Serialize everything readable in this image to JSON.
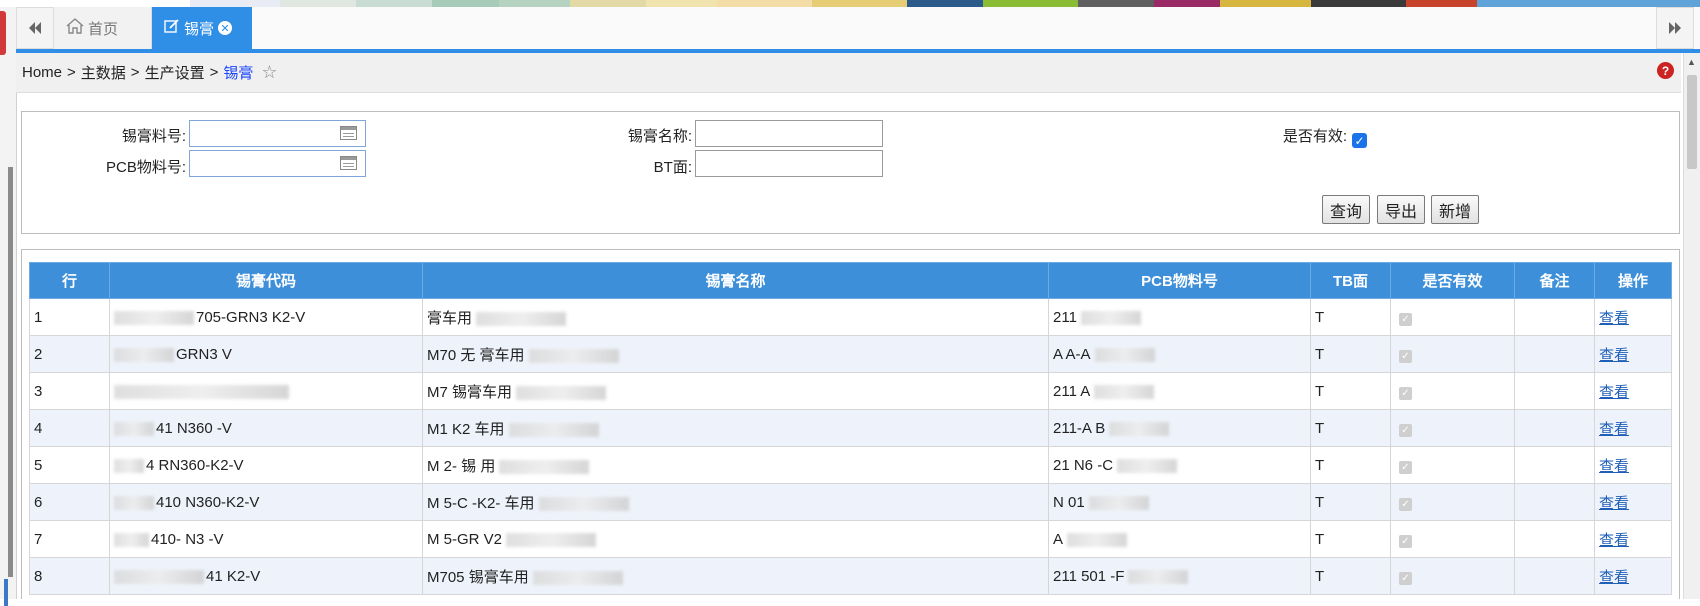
{
  "top_strip_colors": [
    "#ffffff",
    "#e9ecf4",
    "#dfe7e0",
    "#c9dcd3",
    "#a7cbb9",
    "#b6d2c0",
    "#e3d9a6",
    "#f0e3ae",
    "#f3dca6",
    "#e6cd75",
    "#2c5a8a",
    "#8bbc35",
    "#5f5f5f",
    "#9a2a66",
    "#d7b640",
    "#3a3a3a",
    "#c8432b",
    "#5fa3d9"
  ],
  "tabs": {
    "home_label": "首页",
    "active_label": "锡膏",
    "nav_left_icon": "double-chevron-left-icon",
    "nav_right_icon": "double-chevron-right-icon"
  },
  "breadcrumb": {
    "items": [
      "Home",
      "主数据",
      "生产设置"
    ],
    "current": "锡膏",
    "separator": ">"
  },
  "form": {
    "paste_code_label": "锡膏料号:",
    "pcb_code_label": "PCB物料号:",
    "paste_name_label": "锡膏名称:",
    "bt_side_label": "BT面:",
    "active_label": "是否有效:",
    "active_checked": true,
    "query_button": "查询",
    "export_button": "导出",
    "add_button": "新增"
  },
  "grid": {
    "headers": [
      "行",
      "锡膏代码",
      "锡膏名称",
      "PCB物料号",
      "TB面",
      "是否有效",
      "备注",
      "操作"
    ],
    "rows": [
      {
        "row": "1",
        "code": "705-GRN3 K2-V",
        "name": "膏车用",
        "pcb": "211",
        "tb": "T",
        "action": "查看"
      },
      {
        "row": "2",
        "code": "GRN3 V",
        "name": "M70 无 膏车用",
        "pcb": "A A-A",
        "tb": "T",
        "action": "查看"
      },
      {
        "row": "3",
        "code": "",
        "name": "M7 锡膏车用",
        "pcb": "211 A",
        "tb": "T",
        "action": "查看"
      },
      {
        "row": "4",
        "code": "41 N360 -V",
        "name": "M1 K2 车用",
        "pcb": "211-A B",
        "tb": "T",
        "action": "查看"
      },
      {
        "row": "5",
        "code": "4 RN360-K2-V",
        "name": "M 2- 锡 用",
        "pcb": "21 N6 -C",
        "tb": "T",
        "action": "查看"
      },
      {
        "row": "6",
        "code": "410 N360-K2-V",
        "name": "M 5-C -K2- 车用",
        "pcb": "N 01",
        "tb": "T",
        "action": "查看"
      },
      {
        "row": "7",
        "code": "410- N3 -V",
        "name": "M 5-GR V2",
        "pcb": "A",
        "tb": "T",
        "action": "查看"
      },
      {
        "row": "8",
        "code": "41 K2-V",
        "name": "M705 锡膏车用",
        "pcb": "211 501 -F",
        "tb": "T",
        "action": "查看"
      }
    ]
  }
}
